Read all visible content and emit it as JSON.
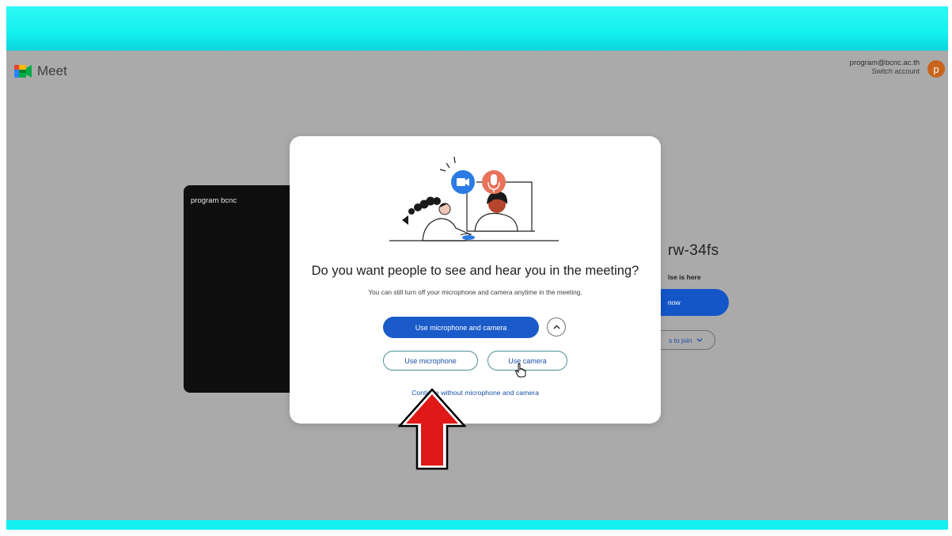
{
  "header": {
    "app_name": "Meet",
    "account_email": "program@bcnc.ac.th",
    "switch_account": "Switch account",
    "avatar_letter": "p"
  },
  "preview": {
    "name": "program bcnc"
  },
  "join_panel": {
    "meeting_code_partial": "rw-34fs",
    "someone_here_partial": "lse is here",
    "join_now_partial": "now",
    "ways_to_join_partial": "s to join"
  },
  "dialog": {
    "title": "Do you want people to see and hear you in the meeting?",
    "subtitle": "You can still turn off your microphone and camera anytime in the meeting.",
    "primary_button": "Use microphone and camera",
    "mic_button": "Use microphone",
    "camera_button": "Use camera",
    "continue_link": "Continue without microphone and camera"
  },
  "colors": {
    "accent_blue": "#1a5bc9",
    "band_cyan": "#12f0ee",
    "overlay_gray": "#aaaaaa",
    "avatar": "#c8641c",
    "annotation_arrow": "#e01818"
  },
  "icons": [
    "meet-logo-icon",
    "chevron-up-icon",
    "chevron-down-icon",
    "pointer-hand-icon",
    "camera-icon",
    "microphone-icon",
    "red-arrow-annotation"
  ]
}
